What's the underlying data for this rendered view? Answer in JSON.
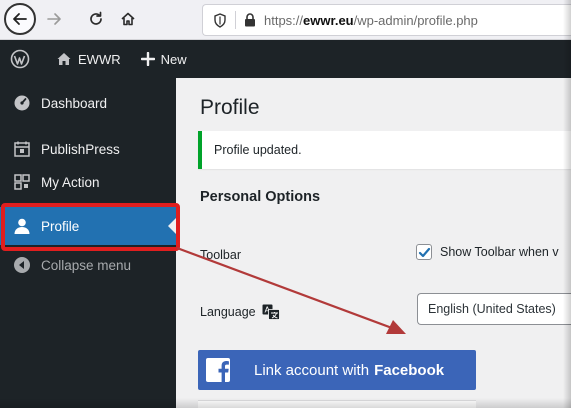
{
  "browser": {
    "url_prefix": "https://",
    "url_domain": "ewwr.eu",
    "url_path": "/wp-admin/profile.php"
  },
  "admin_bar": {
    "site_name": "EWWR",
    "new_label": "New"
  },
  "sidebar": {
    "items": [
      {
        "label": "Dashboard"
      },
      {
        "label": "PublishPress"
      },
      {
        "label": "My Action"
      },
      {
        "label": "Profile"
      },
      {
        "label": "Collapse menu"
      }
    ]
  },
  "main": {
    "page_title": "Profile",
    "notice": "Profile updated.",
    "section_title": "Personal Options",
    "toolbar_label": "Toolbar",
    "toolbar_checkbox_label": "Show Toolbar when v",
    "language_label": "Language",
    "language_value": "English (United States)",
    "facebook_button_text": "Link account with",
    "facebook_button_brand": "Facebook"
  },
  "colors": {
    "admin_dark": "#1d2327",
    "accent_blue": "#2271b1",
    "success_green": "#00a32a",
    "facebook_blue": "#3b65b8",
    "annotation_red": "#e01e1e"
  },
  "icons": {
    "back": "arrow-left-icon",
    "forward": "arrow-right-icon",
    "reload": "reload-icon",
    "home": "home-icon",
    "shield": "shield-icon",
    "lock": "lock-icon",
    "wordpress": "wordpress-logo-icon",
    "dashboard": "gauge-icon",
    "publishpress": "calendar-icon",
    "my_action": "qr-icon",
    "profile": "user-icon",
    "collapse": "collapse-icon",
    "translate": "translate-icon",
    "facebook": "facebook-icon"
  }
}
